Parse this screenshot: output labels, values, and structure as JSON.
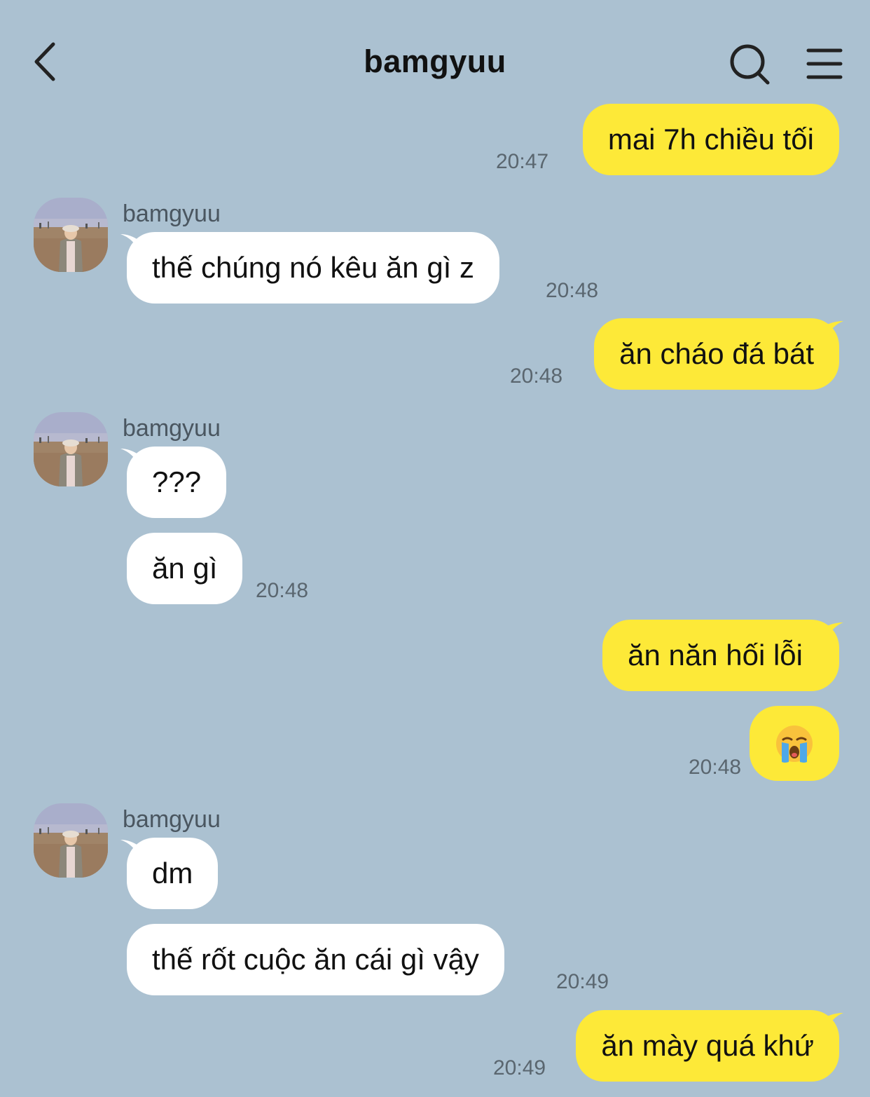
{
  "header": {
    "title": "bamgyuu",
    "back_icon": "chevron-left-icon",
    "search_icon": "search-icon",
    "menu_icon": "hamburger-menu-icon"
  },
  "colors": {
    "background": "#abc1d1",
    "outgoing_bubble": "#fde938",
    "incoming_bubble": "#ffffff"
  },
  "messages": [
    {
      "direction": "out",
      "text": "mai 7h chiều tối",
      "time": "20:47"
    },
    {
      "direction": "in",
      "sender": "bamgyuu",
      "text": "thế chúng nó kêu ăn gì z",
      "time": "20:48"
    },
    {
      "direction": "out",
      "text": "ăn cháo đá bát",
      "time": "20:48"
    },
    {
      "direction": "in",
      "sender": "bamgyuu",
      "text": "???"
    },
    {
      "direction": "in",
      "text": "ăn gì",
      "time": "20:48"
    },
    {
      "direction": "out",
      "text": "ăn năn hối lỗi"
    },
    {
      "direction": "out",
      "emoji": "loudly-crying-face-emoji",
      "time": "20:48"
    },
    {
      "direction": "in",
      "sender": "bamgyuu",
      "text": "dm"
    },
    {
      "direction": "in",
      "text": "thế rốt cuộc ăn cái gì vậy",
      "time": "20:49"
    },
    {
      "direction": "out",
      "text": "ăn mày quá khứ",
      "time": "20:49"
    }
  ]
}
